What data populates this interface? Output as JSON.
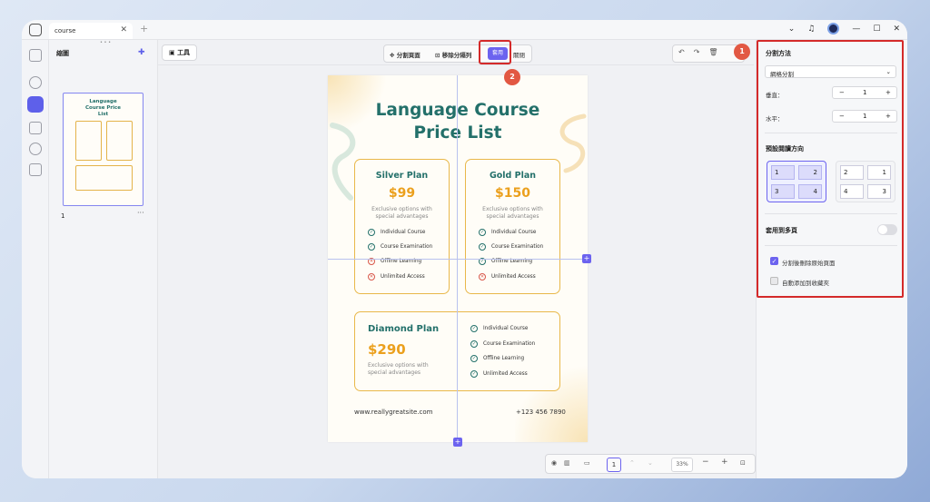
{
  "titlebar": {
    "tab_label": "course",
    "close": "✕",
    "new_tab": "+",
    "drag_dots": "• • •"
  },
  "thumbnails": {
    "title": "縮圖",
    "page_number": "1",
    "more": "···",
    "thumb_title": "Language Course Price List"
  },
  "toolbar": {
    "tools_label": "工具",
    "split_page": "分割頁面",
    "remove_split_lines": "移除分隔列",
    "apply": "套用",
    "close": "關閉"
  },
  "badges": {
    "one": "1",
    "two": "2"
  },
  "page": {
    "title_line1": "Language Course",
    "title_line2": "Price List",
    "silver": {
      "name": "Silver Plan",
      "price": "$99",
      "desc1": "Exclusive options with",
      "desc2": "special advantages",
      "features": [
        {
          "text": "Individual Course",
          "ok": "✓"
        },
        {
          "text": "Course Examination",
          "ok": "✓"
        },
        {
          "text": "Offline Learning",
          "ok": "✕"
        },
        {
          "text": "Unlimited Access",
          "ok": "✕"
        }
      ]
    },
    "gold": {
      "name": "Gold Plan",
      "price": "$150",
      "desc1": "Exclusive options with",
      "desc2": "special advantages",
      "features": [
        {
          "text": "Individual Course",
          "ok": "✓"
        },
        {
          "text": "Course Examination",
          "ok": "✓"
        },
        {
          "text": "Offline Learning",
          "ok": "✓"
        },
        {
          "text": "Unlimited Access",
          "ok": "✕"
        }
      ]
    },
    "diamond": {
      "name": "Diamond Plan",
      "price": "$290",
      "desc1": "Exclusive options with",
      "desc2": "special advantages",
      "features": [
        {
          "text": "Individual Course",
          "ok": "✓"
        },
        {
          "text": "Course Examination",
          "ok": "✓"
        },
        {
          "text": "Offline Learning",
          "ok": "✓"
        },
        {
          "text": "Unlimited Access",
          "ok": "✓"
        }
      ]
    },
    "website": "www.reallygreatsite.com",
    "phone": "+123 456 7890"
  },
  "bottombar": {
    "page": "1",
    "zoom": "33%",
    "minus": "−",
    "plus": "+"
  },
  "panel": {
    "split_method_label": "分割方法",
    "split_method_value": "網格分割",
    "vertical_label": "垂直：",
    "vertical_value": "1",
    "horizontal_label": "水平：",
    "horizontal_value": "1",
    "preview_order_label": "預設閱讀方向",
    "apply_multi_label": "套用到多頁",
    "delete_original_label": "分割後刪除原始頁面",
    "add_bookmark_label": "自動添加到收藏夾"
  },
  "colors": {
    "accent": "#6c63ef",
    "highlight": "#d42a2a",
    "teal": "#23706a",
    "gold": "#eba01d"
  }
}
